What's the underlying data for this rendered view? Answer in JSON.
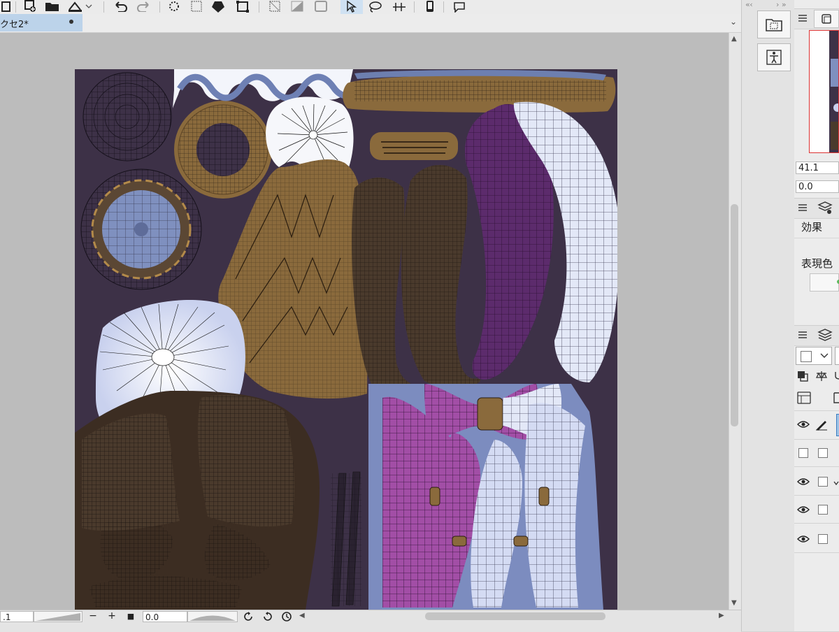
{
  "document": {
    "tab_label": "クセ2*"
  },
  "toolbar": {
    "icons": [
      "new-icon",
      "open-icon",
      "export-icon",
      "undo-icon",
      "redo-icon",
      "loading-icon",
      "grid-icon",
      "fill-icon",
      "transform-icon",
      "clear-selection-icon",
      "invert-icon",
      "frame-icon",
      "select-tool-icon",
      "lasso-icon",
      "ruler-icon",
      "smartphone-icon",
      "help-icon"
    ],
    "active": "select-tool-icon"
  },
  "statusbar": {
    "zoom_value": ".1",
    "angle_value": "0.0",
    "zoom_out_label": "−",
    "zoom_in_label": "+",
    "stop_label": "■"
  },
  "right_panel": {
    "value_1": "41.1",
    "value_2": "0.0",
    "effect_label": "効果",
    "expression_color_label": "表現色"
  },
  "colors": {
    "texture_background": "#3d3147",
    "tab_active": "#bcd3ea",
    "navigator_frame": "#dd3333"
  }
}
